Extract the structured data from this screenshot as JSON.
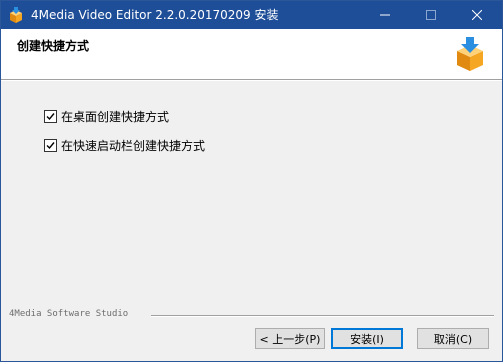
{
  "window": {
    "title": "4Media Video Editor 2.2.0.20170209 安装",
    "icon": "installer-box-icon",
    "controls": {
      "minimize_icon": "minimize-icon",
      "maximize_icon": "maximize-icon",
      "close_icon": "close-icon"
    }
  },
  "header": {
    "title": "创建快捷方式",
    "icon": "package-download-icon"
  },
  "options": [
    {
      "label": "在桌面创建快捷方式",
      "checked": true
    },
    {
      "label": "在快速启动栏创建快捷方式",
      "checked": true
    }
  ],
  "footer": {
    "brand": "4Media Software Studio"
  },
  "buttons": {
    "back": "< 上一步(P)",
    "install": "安装(I)",
    "cancel": "取消(C)"
  },
  "colors": {
    "titlebar": "#1f4e99",
    "accent": "#0078d7",
    "box_orange": "#f5a623",
    "arrow_blue": "#2a8fe0"
  }
}
